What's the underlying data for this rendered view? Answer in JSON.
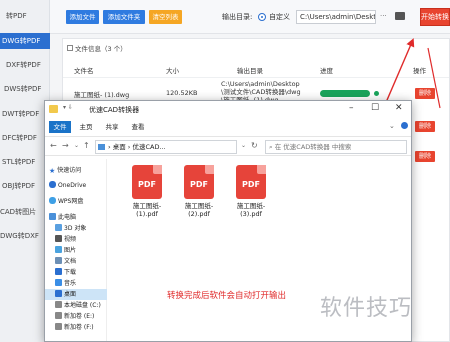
{
  "sidebar": {
    "items": [
      "转PDF",
      "DWG转PDF",
      "DXF转PDF",
      "DWS转PDF",
      "DWT转PDF",
      "DFC转PDF",
      "STL转PDF",
      "OBJ转PDF",
      "CAD转图片",
      "DWG转DXF"
    ]
  },
  "toolbar": {
    "add_file": "添加文件",
    "add_folder": "添加文件夹",
    "clear_list": "清空列表",
    "output_label": "输出目录:",
    "custom_label": "自定义",
    "output_path": "C:\\Users\\admin\\Deskto",
    "more": "···",
    "start": "开始转换"
  },
  "file_list": {
    "title": "文件信息（3 个）",
    "columns": {
      "name": "文件名",
      "size": "大小",
      "path": "输出目录",
      "progress": "进度",
      "action": "操作"
    },
    "rows": [
      {
        "name": "施工图纸- (1).dwg",
        "size": "120.52KB",
        "path_lines": [
          "C:\\Users\\admin\\Desktop",
          "\\测试文件\\CAD转换器\\dwg",
          "\\施工图纸- (1).dwg"
        ],
        "progress": 1.0,
        "delete": "删除"
      },
      {
        "delete": "删除"
      },
      {
        "delete": "删除"
      }
    ]
  },
  "explorer": {
    "title": "优速CAD转换器",
    "ribbon_tabs": [
      "文件",
      "主页",
      "共享",
      "查看"
    ],
    "breadcrumb": [
      "桌面",
      "优速CAD..."
    ],
    "search_placeholder": "在 优速CAD转换器 中搜索",
    "nav_items": [
      "快速访问",
      "OneDrive",
      "WPS网盘",
      "此电脑",
      "3D 对象",
      "视频",
      "图片",
      "文档",
      "下载",
      "音乐",
      "桌面",
      "本地磁盘 (C:)",
      "新加卷 (E:)",
      "新加卷 (F:)"
    ],
    "files": [
      {
        "icon_text": "PDF",
        "name_lines": [
          "施工图纸-",
          "(1).pdf"
        ]
      },
      {
        "icon_text": "PDF",
        "name_lines": [
          "施工图纸-",
          "(2).pdf"
        ]
      },
      {
        "icon_text": "PDF",
        "name_lines": [
          "施工图纸-",
          "(3).pdf"
        ]
      }
    ]
  },
  "annotation": "转换完成后软件会自动打开输出",
  "watermark": "软件技巧",
  "colors": {
    "accent": "#2b6fd0",
    "danger": "#e8442f",
    "progress": "#19a45b",
    "annotation": "#e02b2b"
  }
}
